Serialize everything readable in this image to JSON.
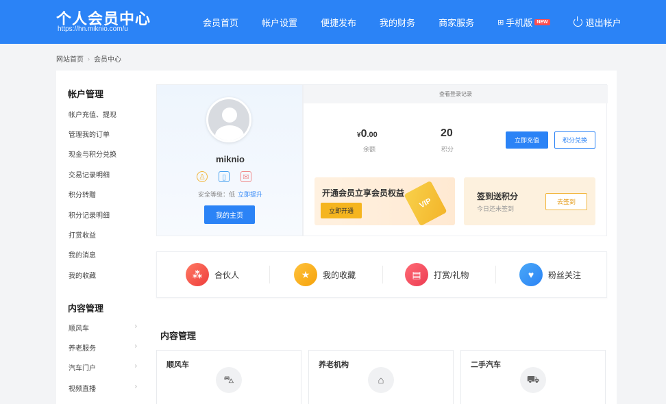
{
  "header": {
    "title": "个人会员中心",
    "url": "https://hn.miknio.com/u",
    "nav": [
      {
        "label": "会员首页"
      },
      {
        "label": "帐户设置"
      },
      {
        "label": "便捷发布"
      },
      {
        "label": "我的财务"
      },
      {
        "label": "商家服务"
      }
    ],
    "mobile": {
      "icon": "qr-grid-icon",
      "label": "手机版",
      "badge": "NEW"
    },
    "logout": {
      "icon": "power-icon",
      "label": "退出帐户"
    },
    "bg_color": "#2b83f6"
  },
  "breadcrumb": {
    "home": "网站首页",
    "separator": "›",
    "current": "会员中心"
  },
  "sidebar": {
    "account_heading": "帐户管理",
    "account_items": [
      "帐户充值、提现",
      "管理我的订单",
      "现金与积分兑换",
      "交易记录明细",
      "积分转赠",
      "积分记录明细",
      "打赏收益",
      "我的消息",
      "我的收藏"
    ],
    "content_heading": "内容管理",
    "content_items": [
      {
        "label": "顺风车",
        "arrow": "›"
      },
      {
        "label": "养老服务",
        "arrow": "›"
      },
      {
        "label": "汽车门户",
        "arrow": "›"
      },
      {
        "label": "视频直播",
        "arrow": "›"
      }
    ]
  },
  "profile": {
    "username": "miknio",
    "badge_icons": [
      "user-verify-icon",
      "phone-verify-icon",
      "email-verify-icon"
    ],
    "security_label": "安全等级：",
    "security_level": "低",
    "security_upgrade": "立即提升",
    "home_button": "我的主页"
  },
  "account": {
    "login_log": "查看登录记录",
    "currency": "¥",
    "balance_int": "0",
    "balance_dec": ".00",
    "balance_label": "余额",
    "points": "20",
    "points_label": "积分",
    "recharge_button": "立即充值",
    "exchange_button": "积分兑换",
    "vip_title": "开通会员立享会员权益",
    "vip_button": "立即开通",
    "vip_card_text": "VIP",
    "sign_title": "签到送积分",
    "sign_sub": "今日还未签到",
    "sign_button": "去签到"
  },
  "quick_entries": [
    {
      "label": "合伙人",
      "icon": "partner-share-icon"
    },
    {
      "label": "我的收藏",
      "icon": "star-icon"
    },
    {
      "label": "打赏/礼物",
      "icon": "gift-icon"
    },
    {
      "label": "粉丝关注",
      "icon": "fans-icon"
    }
  ],
  "content": {
    "heading": "内容管理",
    "cards": [
      {
        "title": "顺风车",
        "icon": "car-icon"
      },
      {
        "title": "养老机构",
        "icon": "home-heart-icon"
      },
      {
        "title": "二手汽车",
        "icon": "used-car-icon"
      }
    ]
  }
}
